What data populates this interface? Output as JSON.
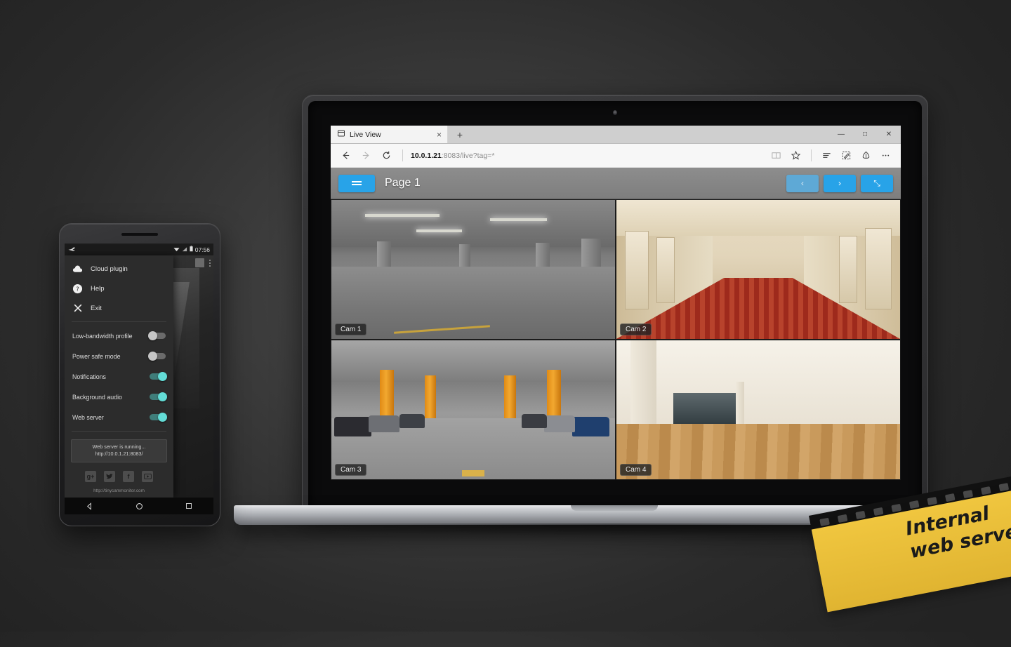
{
  "browser": {
    "name": "microsoft-edge",
    "tab": {
      "title": "Live View",
      "close_label": "×",
      "favicon": "window-icon"
    },
    "newtab_label": "+",
    "window_controls": {
      "minimize": "—",
      "maximize": "□",
      "close": "✕"
    },
    "nav": {
      "back": "←",
      "forward": "→",
      "refresh": "↻"
    },
    "url": {
      "host": "10.0.1.21",
      "rest": ":8083/live?tag=*"
    },
    "toolbar_right": [
      "reading-view-icon",
      "favorites-star-icon",
      "hub-icon",
      "web-note-icon",
      "share-icon",
      "more-icon"
    ]
  },
  "webapp": {
    "menu_button_label": "☰",
    "page_title": "Page 1",
    "prev_label": "‹",
    "next_label": "›",
    "fullscreen_label": "⤡",
    "cameras": [
      {
        "label": "Cam 1",
        "scene": "gray-parking-garage"
      },
      {
        "label": "Cam 2",
        "scene": "hotel-corridor-red-carpet"
      },
      {
        "label": "Cam 3",
        "scene": "orange-pillar-parking-garage"
      },
      {
        "label": "Cam 4",
        "scene": "empty-room-wood-floor"
      }
    ]
  },
  "phone": {
    "status_bar": {
      "app_icon": "camera-icon",
      "time": "07:56",
      "icons": [
        "wifi-icon",
        "signal-icon",
        "battery-icon"
      ]
    },
    "drawer": {
      "items": [
        {
          "label": "Cloud plugin",
          "icon": "cloud-icon"
        },
        {
          "label": "Help",
          "icon": "help-circle-icon"
        },
        {
          "label": "Exit",
          "icon": "close-x-icon"
        }
      ],
      "toggles": [
        {
          "label": "Low-bandwidth profile",
          "state": "off"
        },
        {
          "label": "Power safe mode",
          "state": "off"
        },
        {
          "label": "Notifications",
          "state": "on"
        },
        {
          "label": "Background audio",
          "state": "on"
        },
        {
          "label": "Web server",
          "state": "on"
        }
      ],
      "status_box": {
        "line1": "Web server is running...",
        "line2": "http://10.0.1.21:8083/"
      },
      "social": [
        {
          "name": "google-plus-icon",
          "glyph": "g+"
        },
        {
          "name": "twitter-icon",
          "glyph": "ᴠ"
        },
        {
          "name": "facebook-icon",
          "glyph": "f"
        },
        {
          "name": "youtube-icon",
          "glyph": "▶"
        }
      ],
      "site_url": "http://tinycammonitor.com"
    },
    "background": {
      "stop_icon": "stop-square-icon",
      "overflow_icon": "overflow-dots-icon"
    },
    "nav_bar": {
      "back": "◁",
      "home": "○",
      "recents": "□"
    }
  },
  "ribbon": {
    "line1": "Internal",
    "line2": "web server",
    "color": "#efc63e"
  },
  "colors": {
    "accent_blue": "#28a3e8",
    "toggle_on": "#63dcd6",
    "ribbon_yellow": "#efc63e"
  }
}
